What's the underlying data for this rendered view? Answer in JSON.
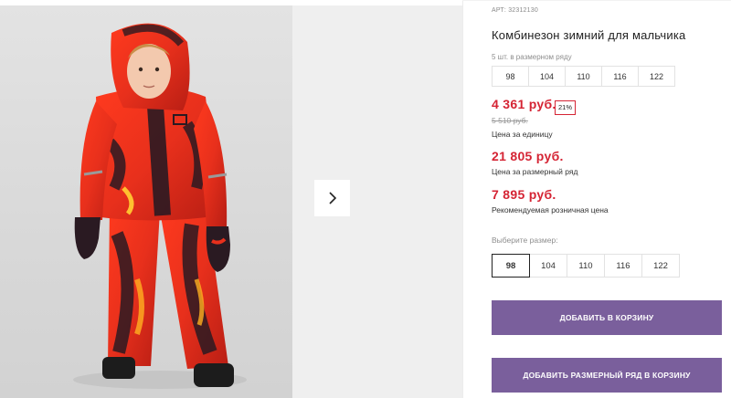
{
  "product": {
    "article": "АРТ: 32312130",
    "title": "Комбинезон зимний для мальчика"
  },
  "size_row": {
    "label": "5 шт. в размерном ряду",
    "sizes": [
      "98",
      "104",
      "110",
      "116",
      "122"
    ]
  },
  "prices": {
    "unit_price": "4 361 руб.",
    "discount": "21%",
    "old_price": "5 510 руб.",
    "unit_caption": "Цена за единицу",
    "row_price": "21 805 руб.",
    "row_caption": "Цена за размерный ряд",
    "retail_price": "7 895 руб.",
    "retail_caption": "Рекомендуемая розничная цена"
  },
  "size_picker": {
    "label": "Выберите размер:",
    "sizes": [
      "98",
      "104",
      "110",
      "116",
      "122"
    ],
    "selected": "98"
  },
  "buttons": {
    "add_to_cart": "ДОБАВИТЬ В КОРЗИНУ",
    "add_row_to_cart": "ДОБАВИТЬ РАЗМЕРНЫЙ РЯД В КОРЗИНУ"
  },
  "gallery": {
    "next_icon": "chevron-right-icon"
  },
  "colors": {
    "price_red": "#d52434",
    "button_purple": "#7a5f9c",
    "suit_red": "#e8301c",
    "suit_dark": "#2a1a22"
  }
}
